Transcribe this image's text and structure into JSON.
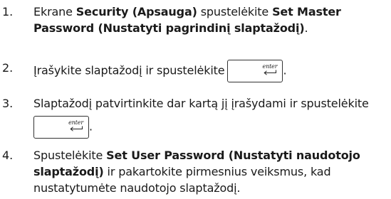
{
  "steps": [
    {
      "number": "1.",
      "pre": "Ekrane ",
      "bold1": "Security (Apsauga)",
      "mid": " spustelėkite ",
      "bold2": "Set Master",
      "bold3": "Password (Nustatyti pagrindinį slaptažodį)",
      "post": "."
    },
    {
      "number": "2.",
      "text": "Įrašykite slaptažodį ir spustelėkite",
      "after": "."
    },
    {
      "number": "3.",
      "text": "Slaptažodį patvirtinkite dar kartą jį įrašydami ir spustelėkite",
      "after": "."
    },
    {
      "number": "4.",
      "pre": "Spustelėkite ",
      "bold1": "Set User Password (Nustatyti naudotojo",
      "bold2": "slaptažodį)",
      "post1": " ir pakartokite pirmesnius veiksmus, kad",
      "post2": "nustatytumėte naudotojo slaptažodį."
    }
  ],
  "enter_key": {
    "label": "enter",
    "icon": "enter-arrow-icon"
  }
}
